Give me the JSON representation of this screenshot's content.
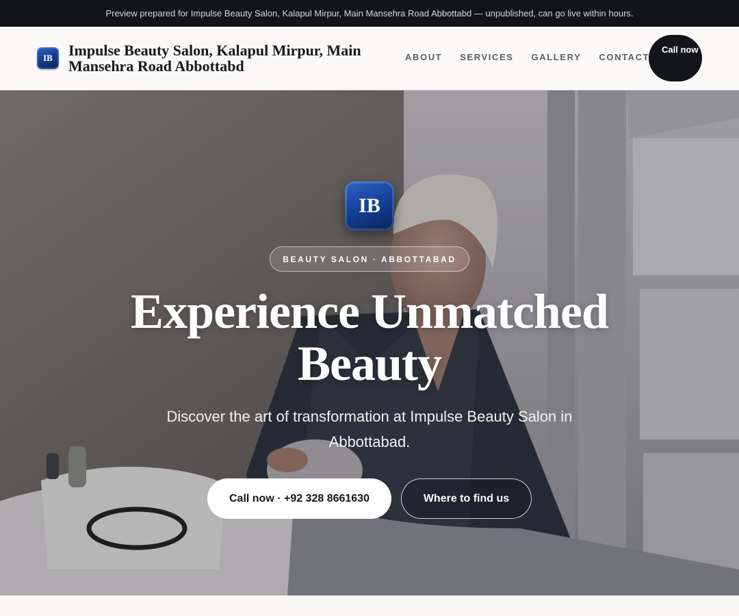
{
  "preview_bar": {
    "text": "Preview prepared for Impulse Beauty Salon, Kalapul Mirpur, Main Mansehra Road Abbottabd — unpublished, can go live within hours."
  },
  "header": {
    "logo_initials": "IB",
    "brand_name": "Impulse Beauty Salon, Kalapul Mirpur, Main Mansehra Road Abbottabd",
    "nav": [
      {
        "label": "ABOUT"
      },
      {
        "label": "SERVICES"
      },
      {
        "label": "GALLERY"
      },
      {
        "label": "CONTACT"
      }
    ],
    "call_button": "Call now"
  },
  "hero": {
    "logo_initials": "IB",
    "badge": "BEAUTY SALON · ABBOTTABAD",
    "headline": "Experience Unmatched Beauty",
    "subtext": "Discover the art of transformation at Impulse Beauty Salon in Abbottabad.",
    "primary_button": "Call now · +92 328 8661630",
    "secondary_button": "Where to find us"
  },
  "colors": {
    "topbar": "#121419",
    "accent_blue": "#123a88",
    "dark_button": "#14151a",
    "page_bg": "#f8f7f4"
  }
}
